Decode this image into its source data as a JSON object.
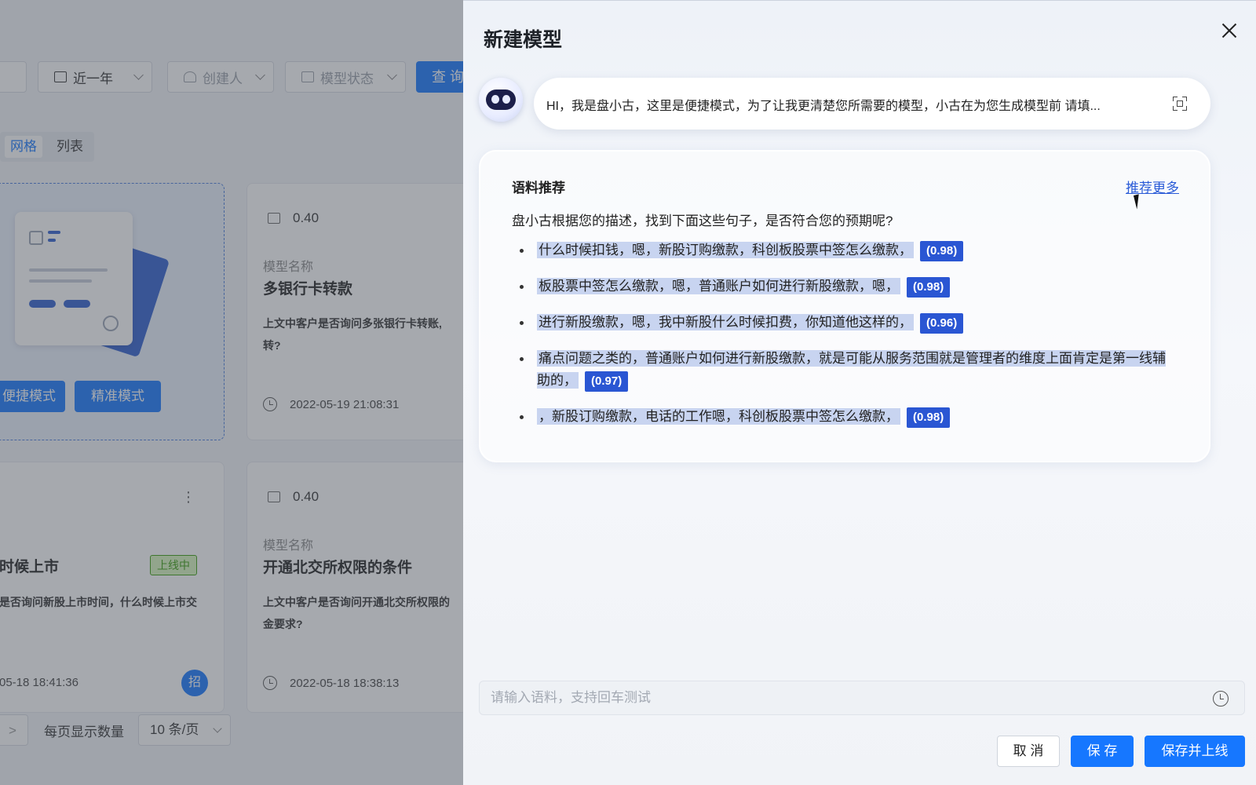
{
  "background": {
    "filters": {
      "date": "近一年",
      "creator": "创建人",
      "status": "模型状态",
      "query": "查 询"
    },
    "view_toggle": {
      "grid": "网格",
      "list": "列表"
    },
    "create_card": {
      "quick_mode": "便捷模式",
      "precise_mode": "精准模式"
    },
    "cards": [
      {
        "score": "0.40",
        "name_label": "模型名称",
        "name": "多银行卡转款",
        "desc_line1": "上文中客户是否询问多张银行卡转账,",
        "desc_line2": "转?",
        "time": "2022-05-19 21:08:31"
      },
      {
        "name": "时候上市",
        "status": "上线中",
        "desc": "是否询问新股上市时间，什么时候上市交",
        "time": "05-18 18:41:36",
        "avatar": "招"
      },
      {
        "score": "0.40",
        "name_label": "模型名称",
        "name": "开通北交所权限的条件",
        "desc_line1": "上文中客户是否询问开通北交所权限的",
        "desc_line2": "金要求?",
        "time": "2022-05-18 18:38:13"
      }
    ],
    "pager": {
      "per_page_label": "每页显示数量",
      "per_page_value": "10 条/页"
    }
  },
  "drawer": {
    "title": "新建模型",
    "bot_message": "HI，我是盘小古，这里是便捷模式，为了让我更清楚您所需要的模型，小古在为您生成模型前 请填...",
    "recommend": {
      "heading": "语料推荐",
      "more_link": "推荐更多",
      "subtitle": "盘小古根据您的描述，找到下面这些句子，是否符合您的预期呢?",
      "items": [
        {
          "text": "什么时候扣钱，嗯，新股订购缴款，科创板股票中签怎么缴款，",
          "score": "(0.98)"
        },
        {
          "text": "板股票中签怎么缴款，嗯，普通账户如何进行新股缴款，嗯，",
          "score": "(0.98)"
        },
        {
          "text": "进行新股缴款，嗯，我中新股什么时候扣费，你知道他这样的，",
          "score": "(0.96)"
        },
        {
          "text": "痛点问题之类的，普通账户如何进行新股缴款，就是可能从服务范围就是管理者的维度上面肯定是第一线辅助的，",
          "score": "(0.97)"
        },
        {
          "text": "，新股订购缴款，电话的工作嗯，科创板股票中签怎么缴款，",
          "score": "(0.98)"
        }
      ]
    },
    "input": {
      "placeholder": "请输入语料，支持回车测试",
      "value": ""
    },
    "buttons": {
      "cancel": "取 消",
      "save": "保 存",
      "save_online": "保存并上线"
    }
  },
  "colors": {
    "primary": "#1677ff",
    "score_tag": "#2a56d3",
    "highlight": "#c8d4f0"
  }
}
